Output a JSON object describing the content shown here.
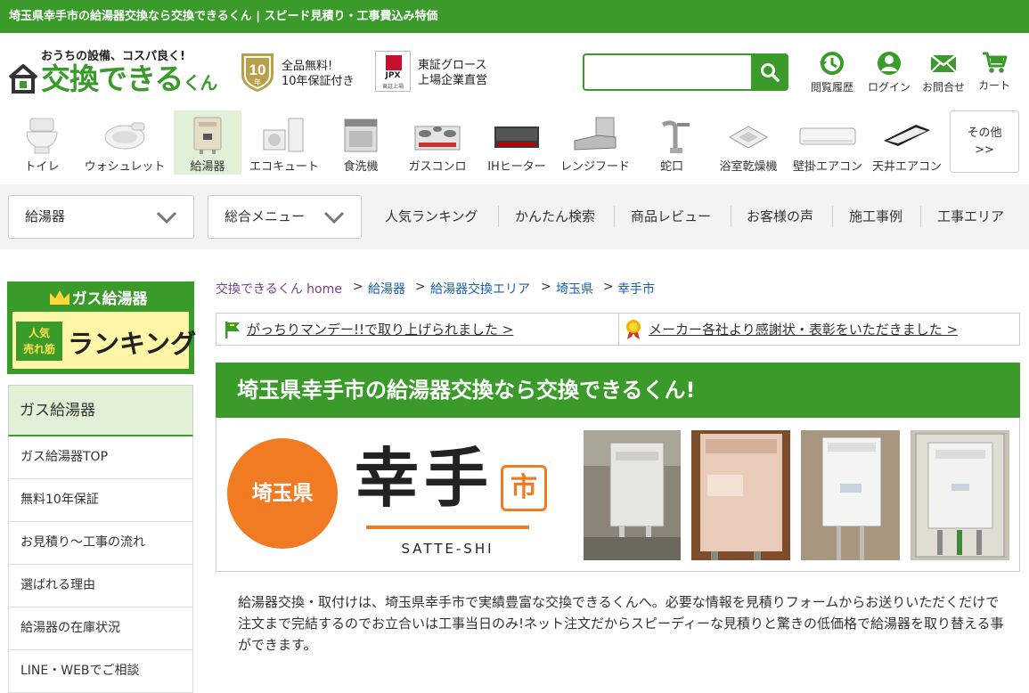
{
  "page": {
    "top_title": "埼玉県幸手市の給湯器交換なら交換できるくん | スピード見積り・工事費込み特価"
  },
  "header": {
    "logo_tagline": "おうちの設備、コスパ良く!",
    "logo_name": "交換できる",
    "logo_suffix": "くん",
    "warranty_badge": "10",
    "warranty_badge_sub": "年",
    "warranty_line1": "全品無料!",
    "warranty_line2": "10年保証付き",
    "jpx_mark": "JPX",
    "jpx_mark_sub": "東証上場",
    "listing_line1": "東証グロース",
    "listing_line2": "上場企業直営",
    "search_value": "",
    "icons": [
      {
        "label": "閲覧履歴",
        "icon": "history-icon"
      },
      {
        "label": "ログイン",
        "icon": "user-icon"
      },
      {
        "label": "お問合せ",
        "icon": "mail-icon"
      },
      {
        "label": "カート",
        "icon": "cart-icon"
      }
    ]
  },
  "categories": [
    {
      "label": "トイレ"
    },
    {
      "label": "ウォシュレット"
    },
    {
      "label": "給湯器",
      "selected": true
    },
    {
      "label": "エコキュート"
    },
    {
      "label": "食洗機"
    },
    {
      "label": "ガスコンロ"
    },
    {
      "label": "IHヒーター"
    },
    {
      "label": "レンジフード"
    },
    {
      "label": "蛇口"
    },
    {
      "label": "浴室乾燥機"
    },
    {
      "label": "壁掛エアコン"
    },
    {
      "label": "天井エアコン"
    }
  ],
  "other_button": {
    "line1": "その他",
    "line2": ">>"
  },
  "menubar": {
    "dropdown1": "給湯器",
    "dropdown2": "総合メニュー",
    "links": [
      "人気ランキング",
      "かんたん検索",
      "商品レビュー",
      "お客様の声",
      "施工事例",
      "工事エリア"
    ]
  },
  "sidebar": {
    "banner_title": "ガス給湯器",
    "banner_tag_line1": "人気",
    "banner_tag_line2": "売れ筋",
    "banner_main": "ランキング",
    "section_title": "ガス給湯器",
    "items": [
      "ガス給湯器TOP",
      "無料10年保証",
      "お見積り〜工事の流れ",
      "選ばれる理由",
      "給湯器の在庫状況",
      "LINE・WEBでご相談"
    ]
  },
  "breadcrumb": [
    {
      "label": "交換できるくん home"
    },
    {
      "label": "給湯器"
    },
    {
      "label": "給湯器交換エリア"
    },
    {
      "label": "埼玉県"
    },
    {
      "label": "幸手市"
    }
  ],
  "breadcrumb_sep": ">",
  "notices": [
    {
      "label": "がっちりマンデー!!で取り上げられました >"
    },
    {
      "label": "メーカー各社より感謝状・表彰をいただきました >"
    }
  ],
  "hero": {
    "title": "埼玉県幸手市の給湯器交換なら交換できるくん!",
    "prefecture": "埼玉県",
    "city": "幸手",
    "city_suffix": "市",
    "city_roman": "SATTE-SHI"
  },
  "description": "給湯器交換・取付けは、埼玉県幸手市で実績豊富な交換できるくんへ。必要な情報を見積りフォームからお送りいただくだけで注文まで完結するのでお立合いは工事当日のみ!ネット注文だからスピーディーな見積りと驚きの低価格で給湯器を取り替える事ができます。",
  "colors": {
    "brand_green": "#3a9a2a",
    "accent_orange": "#f07b22",
    "link_blue": "#1a5fb4"
  }
}
